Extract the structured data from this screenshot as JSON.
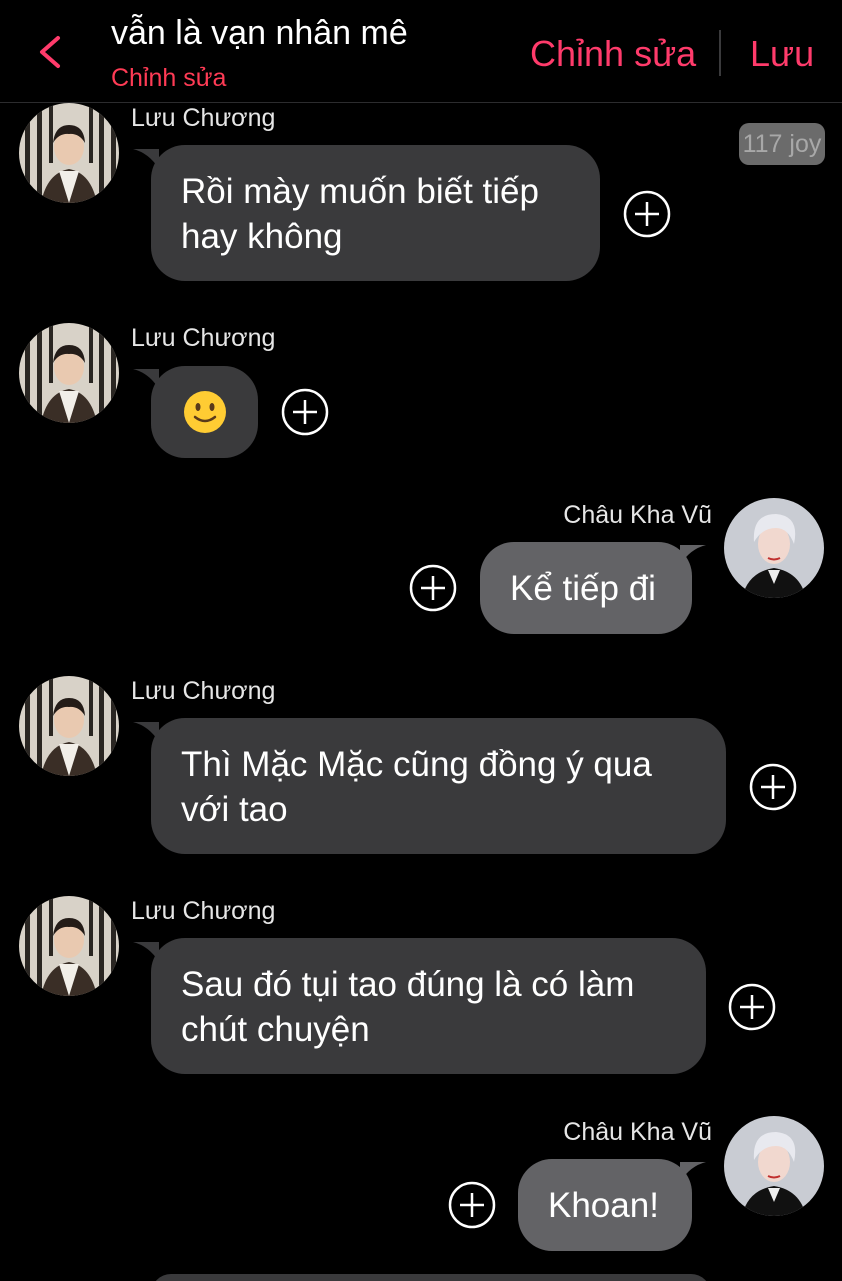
{
  "header": {
    "title": "vẫn là vạn nhân mê",
    "subtitle": "Chỉnh sửa",
    "edit_label": "Chỉnh sửa",
    "save_label": "Lưu",
    "accent_color": "#ff3b6b"
  },
  "badge": {
    "text": "117 joy"
  },
  "messages": [
    {
      "sender": "Lưu Chương",
      "text": "Rồi mày muốn biết tiếp hay không",
      "direction": "incoming"
    },
    {
      "sender": "Lưu Chương",
      "text": "",
      "emoji": "slightly-smiling-face",
      "direction": "incoming"
    },
    {
      "sender": "Châu Kha Vũ",
      "text": "Kể tiếp đi",
      "direction": "outgoing"
    },
    {
      "sender": "Lưu Chương",
      "text": "Thì Mặc Mặc cũng đồng ý qua với tao",
      "direction": "incoming"
    },
    {
      "sender": "Lưu Chương",
      "text": "Sau đó tụi tao đúng là có làm chút chuyện",
      "direction": "incoming"
    },
    {
      "sender": "Châu Kha Vũ",
      "text": "Khoan!",
      "direction": "outgoing"
    }
  ],
  "colors": {
    "incoming_bubble": "#3a3a3c",
    "outgoing_bubble": "#636366"
  }
}
